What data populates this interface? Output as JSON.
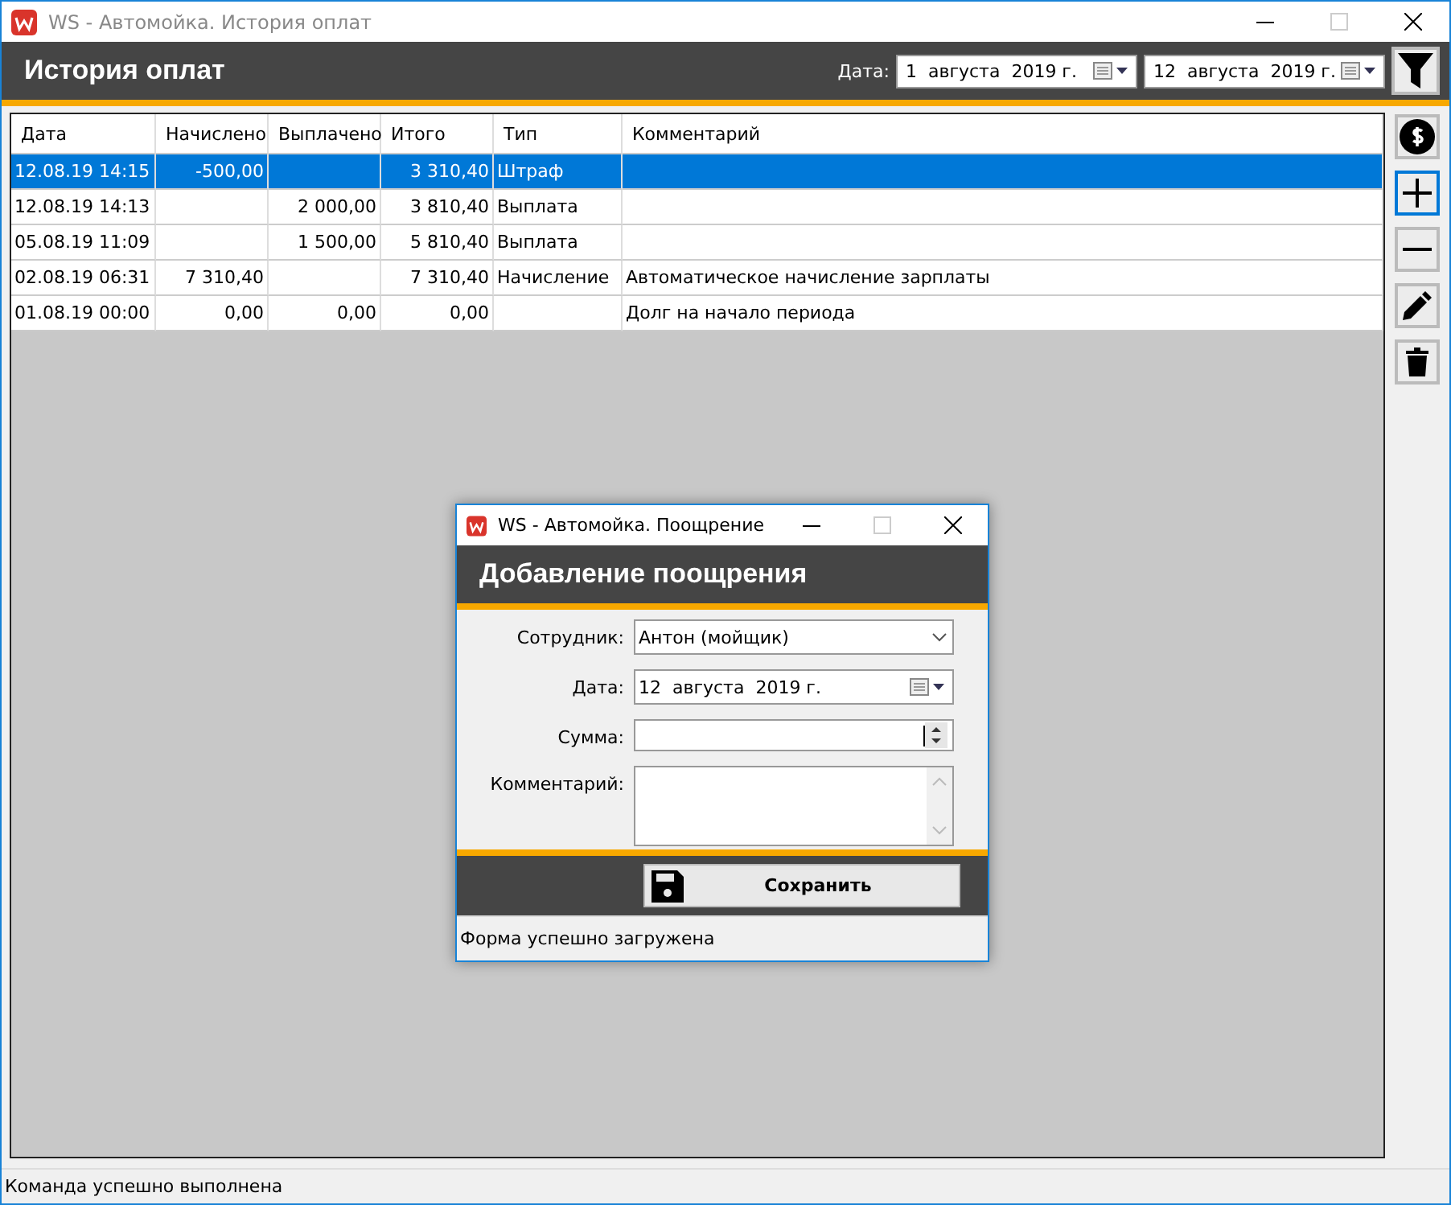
{
  "window": {
    "title": "WS - Автомойка. История оплат"
  },
  "header": {
    "title": "История оплат",
    "date_label": "Дата:",
    "date_from": "1  августа  2019 г.",
    "date_to": "12  августа  2019 г."
  },
  "table": {
    "columns": [
      "Дата",
      "Начислено",
      "Выплачено",
      "Итого",
      "Тип",
      "Комментарий"
    ],
    "rows": [
      {
        "cells": [
          "12.08.19 14:15",
          "-500,00",
          null,
          "3 310,40",
          "Штраф",
          null
        ],
        "selected": true
      },
      {
        "cells": [
          "12.08.19 14:13",
          null,
          "2 000,00",
          "3 810,40",
          "Выплата",
          null
        ],
        "selected": false
      },
      {
        "cells": [
          "05.08.19 11:09",
          null,
          "1 500,00",
          "5 810,40",
          "Выплата",
          null
        ],
        "selected": false
      },
      {
        "cells": [
          "02.08.19 06:31",
          "7 310,40",
          null,
          "7 310,40",
          "Начисление",
          "Автоматическое начисление зарплаты"
        ],
        "selected": false
      },
      {
        "cells": [
          "01.08.19 00:00",
          "0,00",
          "0,00",
          "0,00",
          null,
          "Долг на начало периода"
        ],
        "selected": false
      }
    ]
  },
  "toolbar": [
    {
      "kind": "money",
      "focused": false
    },
    {
      "kind": "add",
      "focused": true
    },
    {
      "kind": "remove",
      "focused": false
    },
    {
      "kind": "edit",
      "focused": false
    },
    {
      "kind": "delete",
      "focused": false
    }
  ],
  "dialog": {
    "title": "WS - Автомойка. Поощрение",
    "header": "Добавление поощрения",
    "fields": [
      {
        "kind": "select",
        "label": "Сотрудник:",
        "value": "Антон (мойщик)"
      },
      {
        "kind": "date",
        "label": "Дата:",
        "value": "12  августа  2019 г."
      },
      {
        "kind": "number",
        "label": "Сумма:"
      },
      {
        "kind": "textarea",
        "label": "Комментарий:"
      }
    ],
    "save_button": "Сохранить",
    "status": "Форма успешно загружена"
  },
  "status_bar": "Команда успешно выполнена"
}
